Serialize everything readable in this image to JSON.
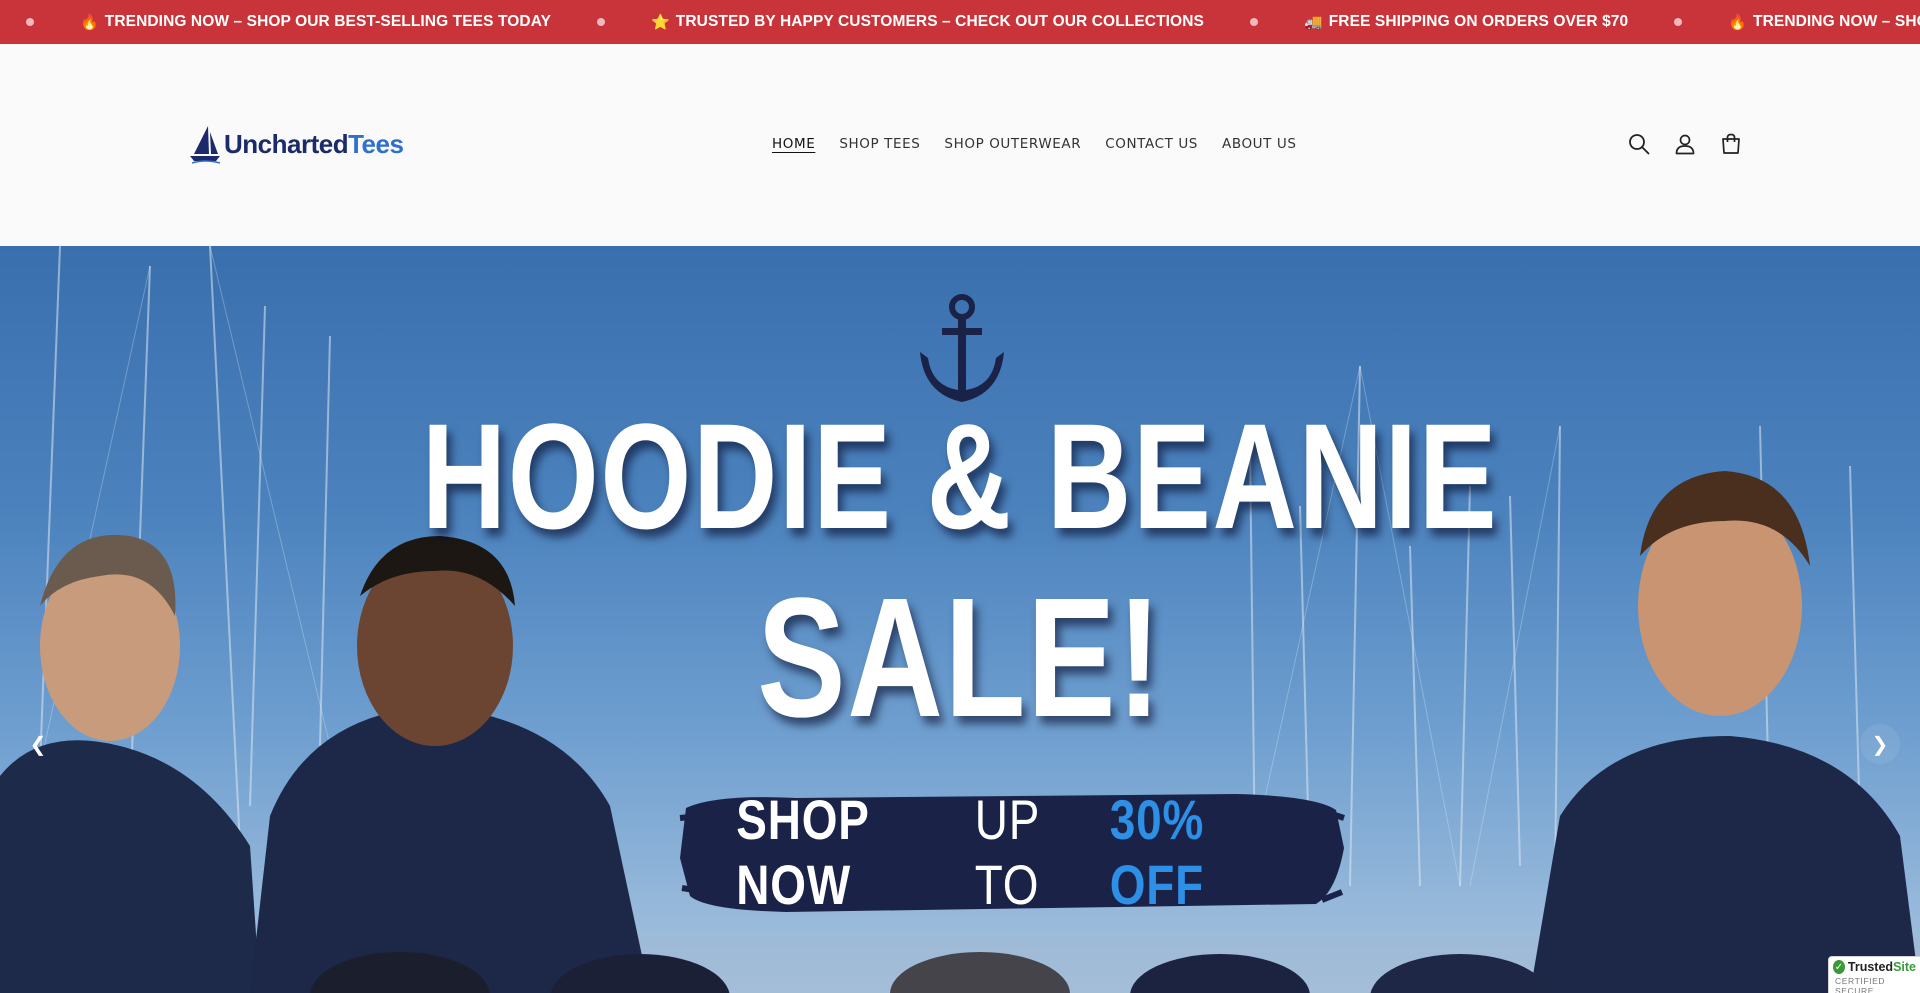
{
  "announcement": {
    "items": [
      {
        "emoji": "🔥",
        "text": "TRENDING NOW – SHOP OUR BEST-SELLING TEES TODAY"
      },
      {
        "emoji": "⭐",
        "text": "TRUSTED BY HAPPY CUSTOMERS – CHECK OUT OUR COLLECTIONS"
      },
      {
        "emoji": "🚚",
        "text": "FREE SHIPPING ON ORDERS OVER $70"
      },
      {
        "emoji": "🔥",
        "text": "TRENDING NOW – SHOP OUR"
      }
    ],
    "background": "#c9343a"
  },
  "header": {
    "logo": {
      "part1": "Uncharted",
      "part2": "Tees"
    },
    "nav": [
      {
        "label": "HOME",
        "active": true
      },
      {
        "label": "SHOP TEES",
        "active": false
      },
      {
        "label": "SHOP OUTERWEAR",
        "active": false
      },
      {
        "label": "CONTACT US",
        "active": false
      },
      {
        "label": "ABOUT US",
        "active": false
      }
    ],
    "icons": [
      "search-icon",
      "account-icon",
      "cart-icon"
    ]
  },
  "hero": {
    "title_line1": "HOODIE & BEANIE",
    "title_line2": "SALE!",
    "cta_part1": "SHOP NOW",
    "cta_part2": "UP TO",
    "cta_part3": "30% OFF",
    "prev_arrow": "❮",
    "next_arrow": "❯",
    "accent_color": "#2e8fe6",
    "navy": "#1a2347"
  },
  "trust_badge": {
    "name_part1": "Trusted",
    "name_part2": "Site",
    "sub": "CERTIFIED SECURE"
  }
}
